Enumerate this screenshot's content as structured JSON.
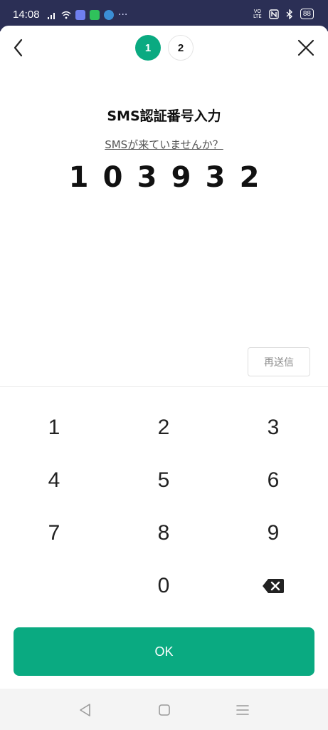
{
  "status_bar": {
    "time": "14:08",
    "volte": "VO LTE",
    "battery": "88",
    "more": "···"
  },
  "stepper": {
    "steps": [
      "1",
      "2"
    ],
    "active_step": "1"
  },
  "main": {
    "title": "SMS認証番号入力",
    "help_link": "SMSが来ていませんか？",
    "code_digits": [
      "1",
      "0",
      "3",
      "9",
      "3",
      "2"
    ],
    "resend_label": "再送信"
  },
  "keypad": {
    "keys": [
      "1",
      "2",
      "3",
      "4",
      "5",
      "6",
      "7",
      "8",
      "9",
      "0"
    ]
  },
  "ok_label": "OK",
  "colors": {
    "accent": "#0aaa81",
    "status_bar": "#2b2f55"
  },
  "icons": {
    "back": "chevron-left-icon",
    "close": "close-icon",
    "delete": "backspace-icon",
    "nav_back": "triangle-back-icon",
    "nav_home": "square-home-icon",
    "nav_menu": "menu-lines-icon"
  }
}
